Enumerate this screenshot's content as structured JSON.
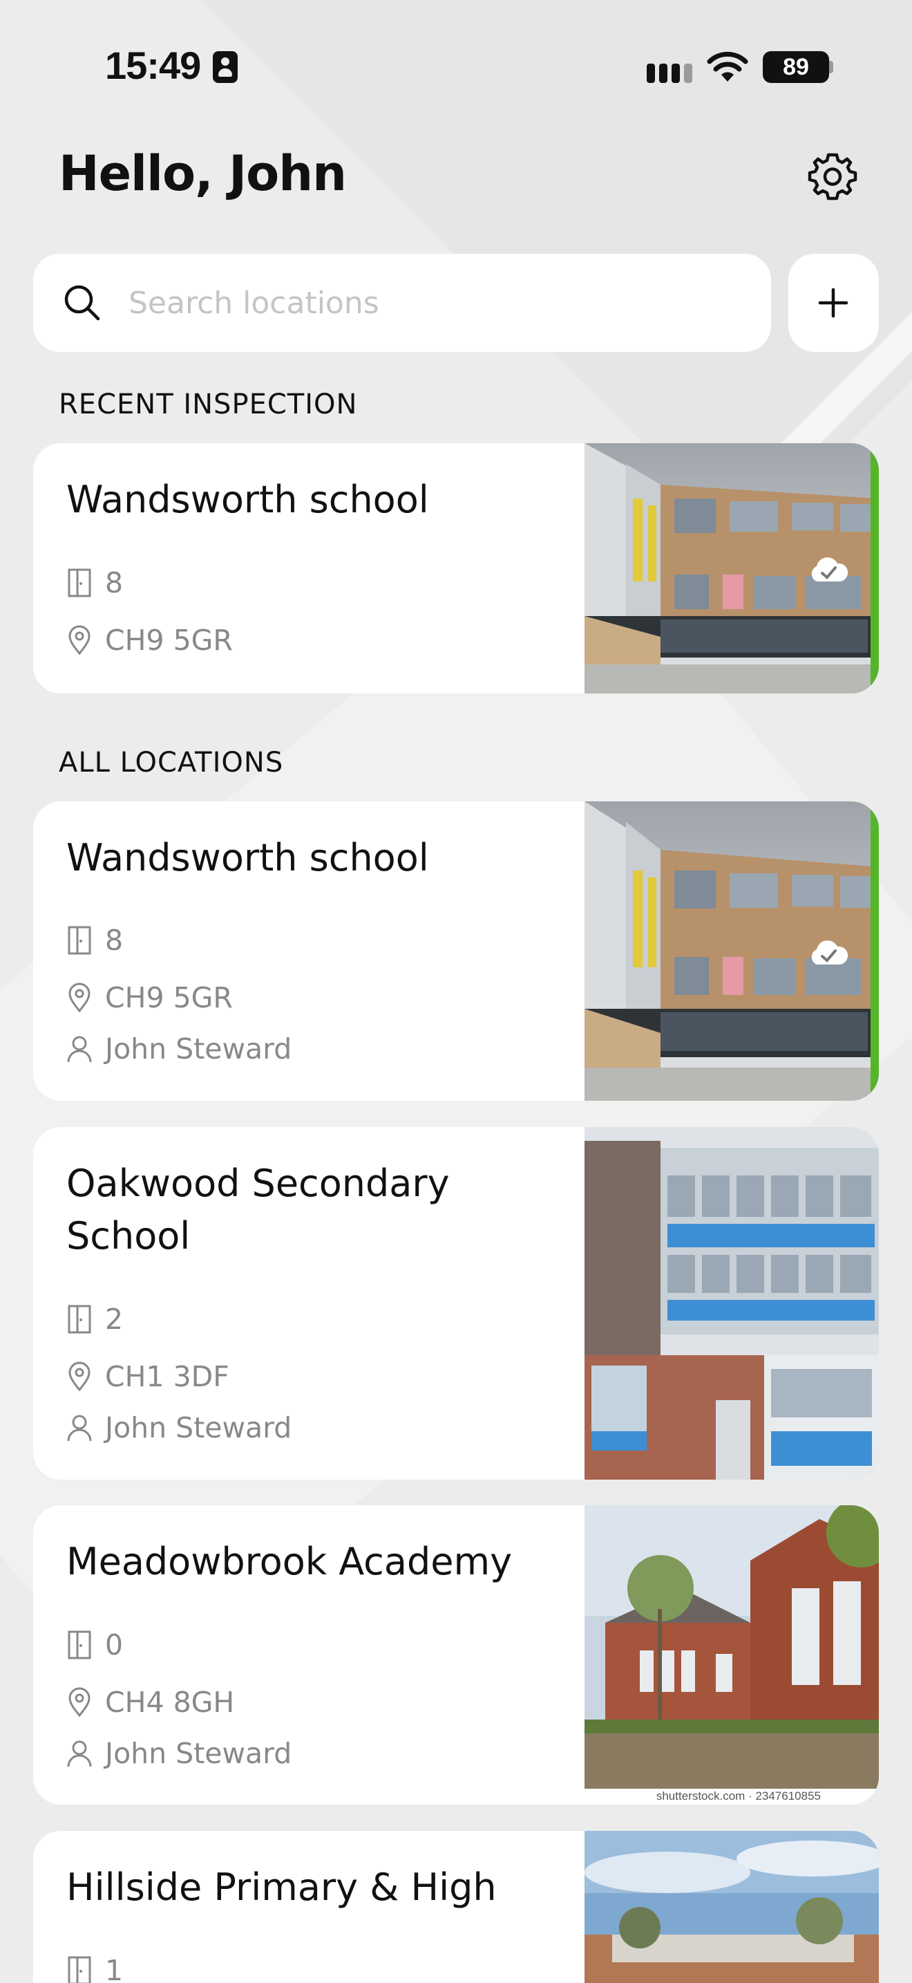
{
  "status_bar": {
    "time": "15:49",
    "battery": "89",
    "icons": [
      "contact-card-icon",
      "signal-icon",
      "wifi-icon",
      "battery-icon"
    ]
  },
  "header": {
    "greeting": "Hello, John",
    "settings_icon": "gear-icon"
  },
  "search": {
    "placeholder": "Search locations",
    "value": "",
    "add_icon": "plus-icon"
  },
  "sections": {
    "recent": "RECENT INSPECTION",
    "all": "ALL LOCATIONS"
  },
  "colors": {
    "accent": "#55b529",
    "muted_text": "#888888",
    "background": "#ececec"
  },
  "recent_inspection": {
    "title": "Wandsworth school",
    "doors": "8",
    "postcode": "CH9 5GR",
    "synced": true
  },
  "locations": [
    {
      "title": "Wandsworth school",
      "doors": "8",
      "postcode": "CH9 5GR",
      "owner": "John Steward",
      "synced": true
    },
    {
      "title": "Oakwood Secondary School",
      "doors": "2",
      "postcode": "CH1 3DF",
      "owner": "John Steward",
      "synced": false
    },
    {
      "title": "Meadowbrook Academy",
      "doors": "0",
      "postcode": "CH4 8GH",
      "owner": "John Steward",
      "synced": false,
      "image_caption": "shutterstock.com · 2347610855"
    },
    {
      "title": "Hillside Primary & High",
      "doors": "1",
      "postcode": "",
      "owner": "",
      "synced": false
    }
  ]
}
